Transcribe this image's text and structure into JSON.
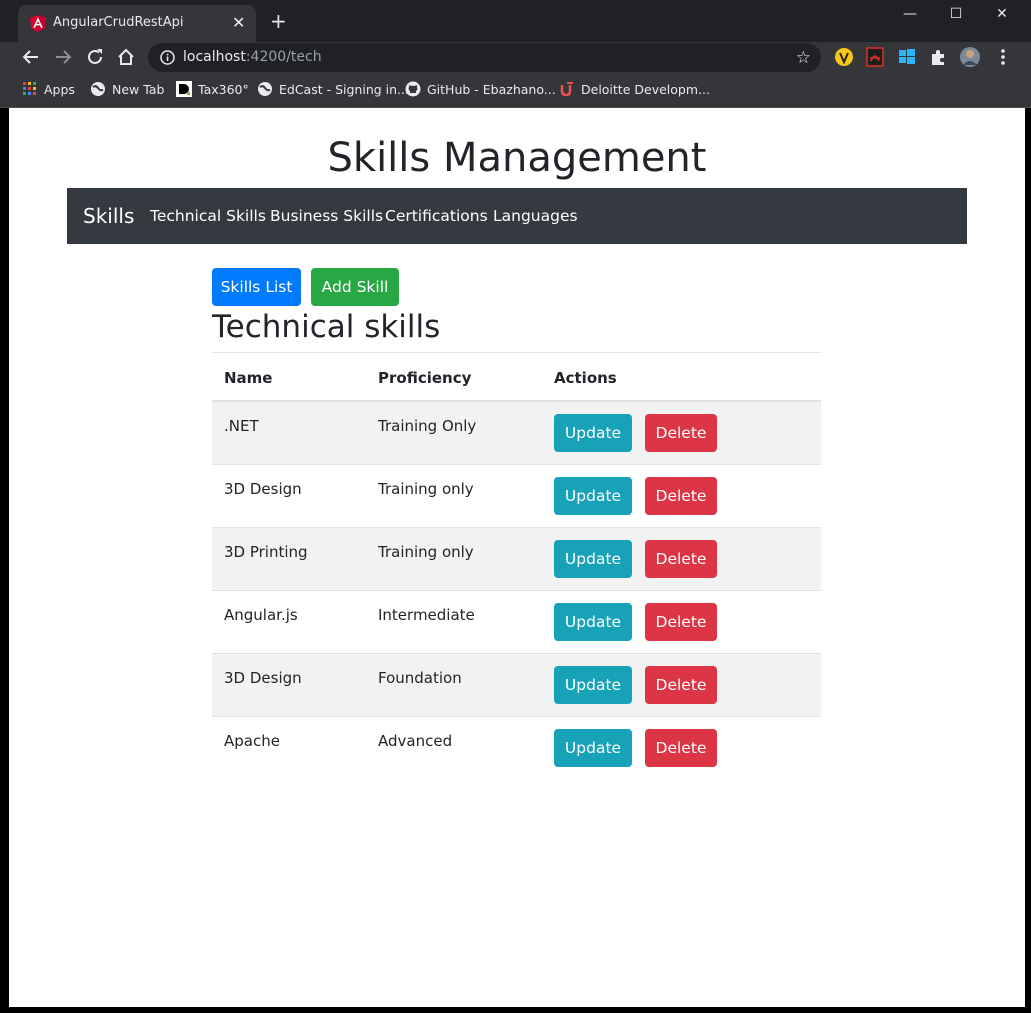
{
  "browser": {
    "tab_title": "AngularCrudRestApi",
    "tab_close": "✕",
    "new_tab": "+",
    "url_host": "localhost",
    "url_path": ":4200/tech",
    "window_controls": {
      "minimize": "—",
      "maximize": "☐",
      "close": "✕"
    },
    "bookmarks": [
      {
        "label": "Apps",
        "icon": "apps-grid-icon"
      },
      {
        "label": "New Tab",
        "icon": "globe-icon"
      },
      {
        "label": "Tax360°",
        "icon": "d-logo-icon"
      },
      {
        "label": "EdCast - Signing in...",
        "icon": "globe-icon"
      },
      {
        "label": "GitHub - Ebazhano...",
        "icon": "github-icon"
      },
      {
        "label": "Deloitte Developm...",
        "icon": "udemy-icon"
      }
    ]
  },
  "app": {
    "title": "Skills Management",
    "brand": "Skills",
    "nav": [
      "Technical Skills",
      "Business Skills",
      "Certifications",
      "Languages"
    ],
    "skills_list_button": "Skills List",
    "add_skill_button": "Add Skill",
    "section_title": "Technical skills",
    "columns": [
      "Name",
      "Proficiency",
      "Actions"
    ],
    "rows": [
      {
        "name": ".NET",
        "proficiency": "Training Only"
      },
      {
        "name": "3D Design",
        "proficiency": "Training only"
      },
      {
        "name": "3D Printing",
        "proficiency": "Training only"
      },
      {
        "name": "Angular.js",
        "proficiency": "Intermediate"
      },
      {
        "name": "3D Design",
        "proficiency": "Foundation"
      },
      {
        "name": "Apache",
        "proficiency": "Advanced"
      }
    ],
    "update_label": "Update",
    "delete_label": "Delete"
  },
  "colors": {
    "primary": "#007bff",
    "success": "#28a745",
    "info": "#17a2b8",
    "danger": "#dc3545",
    "navbar": "#343a40"
  }
}
